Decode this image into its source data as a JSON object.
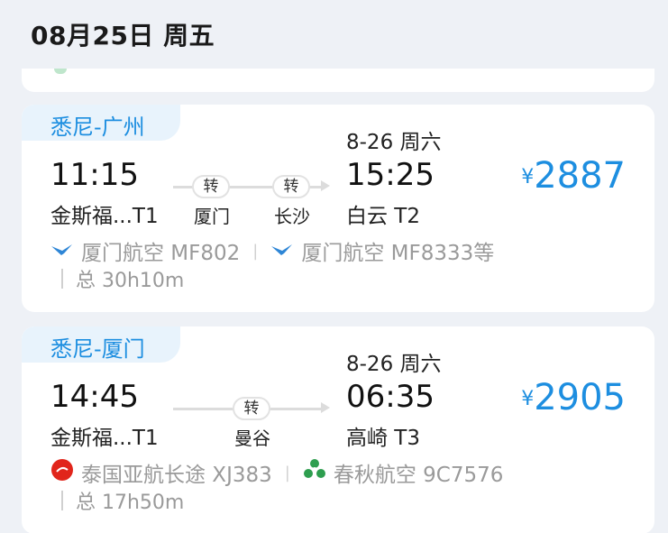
{
  "date_header": "08月25日 周五",
  "flights": [
    {
      "route": "悉尼-广州",
      "dep_time": "11:15",
      "dep_airport": "金斯福...T1",
      "arr_date": "8-26 周六",
      "arr_time": "15:25",
      "arr_airport": "白云 T2",
      "transfers": [
        {
          "badge": "转",
          "city": "厦门"
        },
        {
          "badge": "转",
          "city": "长沙"
        }
      ],
      "price_symbol": "¥",
      "price": "2887",
      "airline_1": "厦门航空 MF802",
      "airline_2": "厦门航空 MF8333等",
      "duration": "总 30h10m",
      "icon_1": "xiamen-airlines-egret-icon",
      "icon_2": "xiamen-airlines-egret-icon"
    },
    {
      "route": "悉尼-厦门",
      "dep_time": "14:45",
      "dep_airport": "金斯福...T1",
      "arr_date": "8-26 周六",
      "arr_time": "06:35",
      "arr_airport": "高崎 T3",
      "transfers": [
        {
          "badge": "转",
          "city": "曼谷"
        }
      ],
      "price_symbol": "¥",
      "price": "2905",
      "airline_1": "泰国亚航长途 XJ383",
      "airline_2": "春秋航空 9C7576",
      "duration": "总 17h50m",
      "icon_1": "airasia-logo-icon",
      "icon_2": "spring-airlines-logo-icon"
    }
  ],
  "colors": {
    "accent": "#1d8ee0",
    "route_tag_bg": "#e8f3fc",
    "page_bg": "#eef1f6",
    "airasia_red": "#e1251b",
    "spring_green": "#2e9e4f"
  }
}
